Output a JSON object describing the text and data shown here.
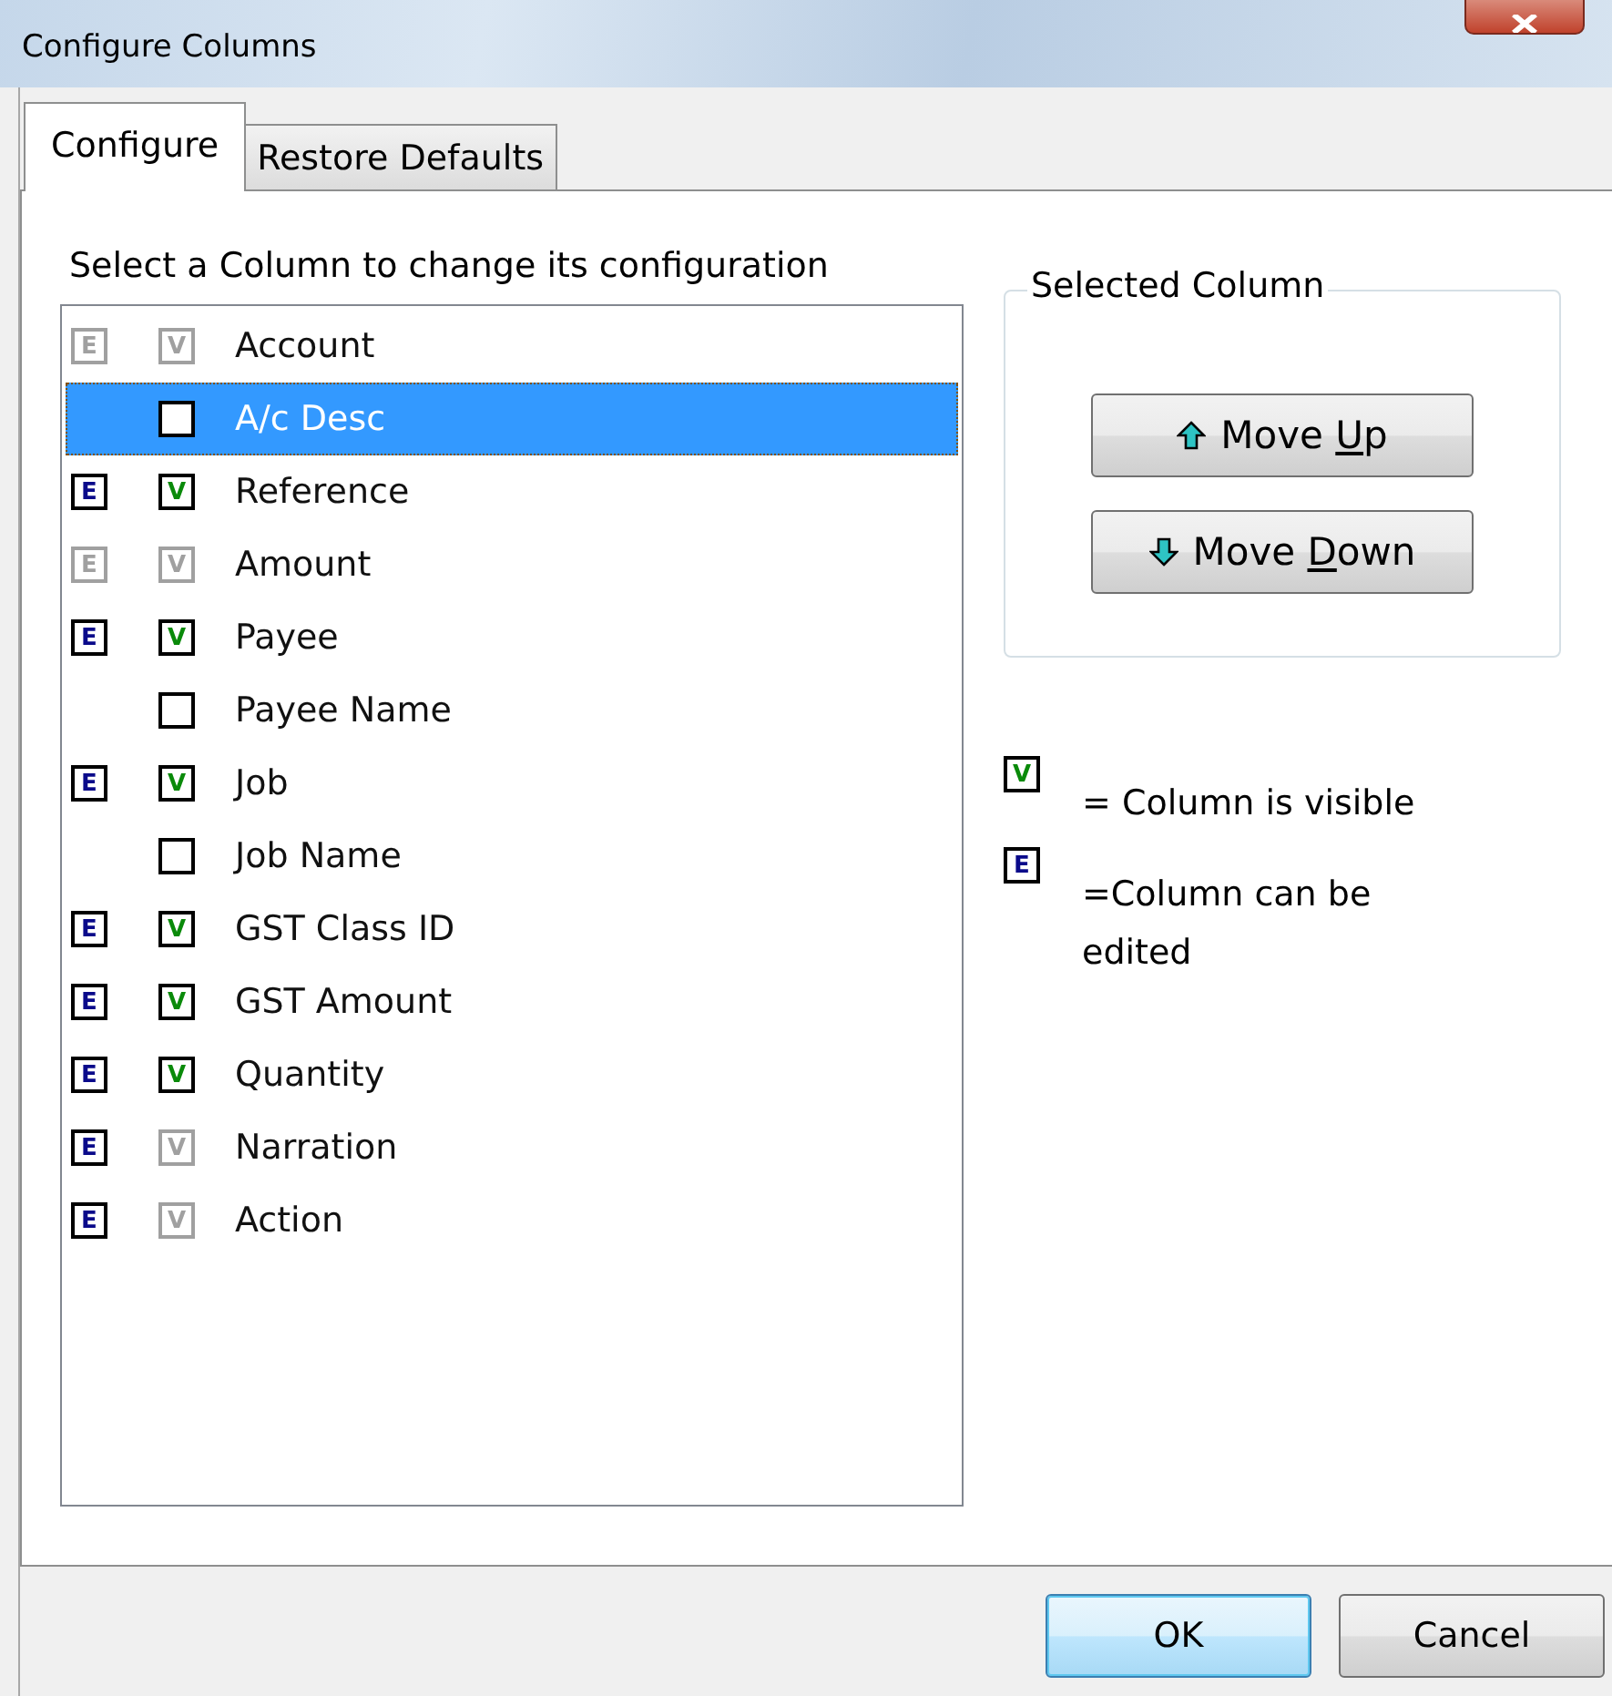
{
  "window": {
    "title": "Configure Columns"
  },
  "tabs": [
    {
      "label": "Configure",
      "selected": true
    },
    {
      "label": "Restore Defaults",
      "selected": false
    }
  ],
  "instruction": "Select a Column to change its configuration",
  "columns": [
    {
      "label": "Account",
      "selected": false,
      "edit": "E",
      "edit_checked": true,
      "edit_disabled": true,
      "visible": "V",
      "visible_checked": true,
      "visible_disabled": true
    },
    {
      "label": "A/c Desc",
      "selected": true
    },
    {
      "label": "Reference",
      "selected": false,
      "edit": "E",
      "edit_checked": true,
      "edit_disabled": false,
      "visible": "V",
      "visible_checked": true,
      "visible_disabled": false
    },
    {
      "label": "Amount",
      "selected": false,
      "edit": "E",
      "edit_checked": true,
      "edit_disabled": true,
      "visible": "V",
      "visible_checked": true,
      "visible_disabled": true
    },
    {
      "label": "Payee",
      "selected": false,
      "edit": "E",
      "edit_checked": true,
      "edit_disabled": false,
      "visible": "V",
      "visible_checked": true,
      "visible_disabled": false
    },
    {
      "label": "Payee Name",
      "selected": false
    },
    {
      "label": "Job",
      "selected": false,
      "edit": "E",
      "edit_checked": true,
      "edit_disabled": false,
      "visible": "V",
      "visible_checked": true,
      "visible_disabled": false
    },
    {
      "label": "Job Name",
      "selected": false
    },
    {
      "label": "GST Class ID",
      "selected": false,
      "edit": "E",
      "edit_checked": true,
      "edit_disabled": false,
      "visible": "V",
      "visible_checked": true,
      "visible_disabled": false
    },
    {
      "label": "GST Amount",
      "selected": false,
      "edit": "E",
      "edit_checked": true,
      "edit_disabled": false,
      "visible": "V",
      "visible_checked": true,
      "visible_disabled": false
    },
    {
      "label": "Quantity",
      "selected": false,
      "edit": "E",
      "edit_checked": true,
      "edit_disabled": false,
      "visible": "V",
      "visible_checked": true,
      "visible_disabled": false
    },
    {
      "label": "Narration",
      "selected": false,
      "edit": "E",
      "edit_checked": true,
      "edit_disabled": false,
      "visible": "V",
      "visible_checked": true,
      "visible_disabled": true
    },
    {
      "label": "Action",
      "selected": false,
      "edit": "E",
      "edit_checked": true,
      "edit_disabled": false,
      "visible": "V",
      "visible_checked": true,
      "visible_disabled": true
    }
  ],
  "selected_column": {
    "title": "Selected Column",
    "buttons": [
      {
        "label": "Move Up",
        "access_key_shown": true,
        "kind": "up"
      },
      {
        "label": "Move Down",
        "access_key_shown": true,
        "kind": "down"
      }
    ]
  },
  "legend": [
    {
      "mark": "V",
      "kind": "visible",
      "text": "= Column is visible"
    },
    {
      "mark": "E",
      "kind": "edit",
      "text": "=Column can be edited"
    }
  ],
  "buttons": [
    {
      "label": "OK",
      "default": true
    },
    {
      "label": "Cancel",
      "default": false
    }
  ]
}
